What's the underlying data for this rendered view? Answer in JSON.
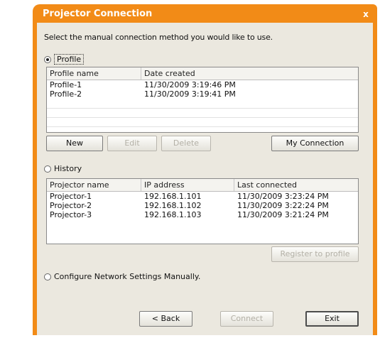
{
  "window": {
    "title": "Projector Connection",
    "close": "x"
  },
  "instruction": "Select the manual connection method you would like to use.",
  "profile_section": {
    "label": "Profile",
    "selected": true,
    "columns": [
      "Profile name",
      "Date created"
    ],
    "rows": [
      [
        "Profile-1",
        "11/30/2009 3:19:46 PM"
      ],
      [
        "Profile-2",
        "11/30/2009 3:19:41 PM"
      ]
    ],
    "buttons": {
      "new": "New",
      "edit": "Edit",
      "delete": "Delete",
      "my_connection": "My Connection"
    }
  },
  "history_section": {
    "label": "History",
    "selected": false,
    "columns": [
      "Projector name",
      "IP address",
      "Last connected"
    ],
    "rows": [
      [
        "Projector-1",
        "192.168.1.101",
        "11/30/2009 3:23:24 PM"
      ],
      [
        "Projector-2",
        "192.168.1.102",
        "11/30/2009 3:22:24 PM"
      ],
      [
        "Projector-3",
        "192.168.1.103",
        "11/30/2009 3:21:24 PM"
      ]
    ],
    "register_button": "Register to profile"
  },
  "manual_option": {
    "label": "Configure Network Settings Manually.",
    "selected": false
  },
  "footer": {
    "back": "< Back",
    "connect": "Connect",
    "exit": "Exit"
  },
  "colors": {
    "title_bar": "#f28b17",
    "dialog_bg": "#ebe8df"
  }
}
